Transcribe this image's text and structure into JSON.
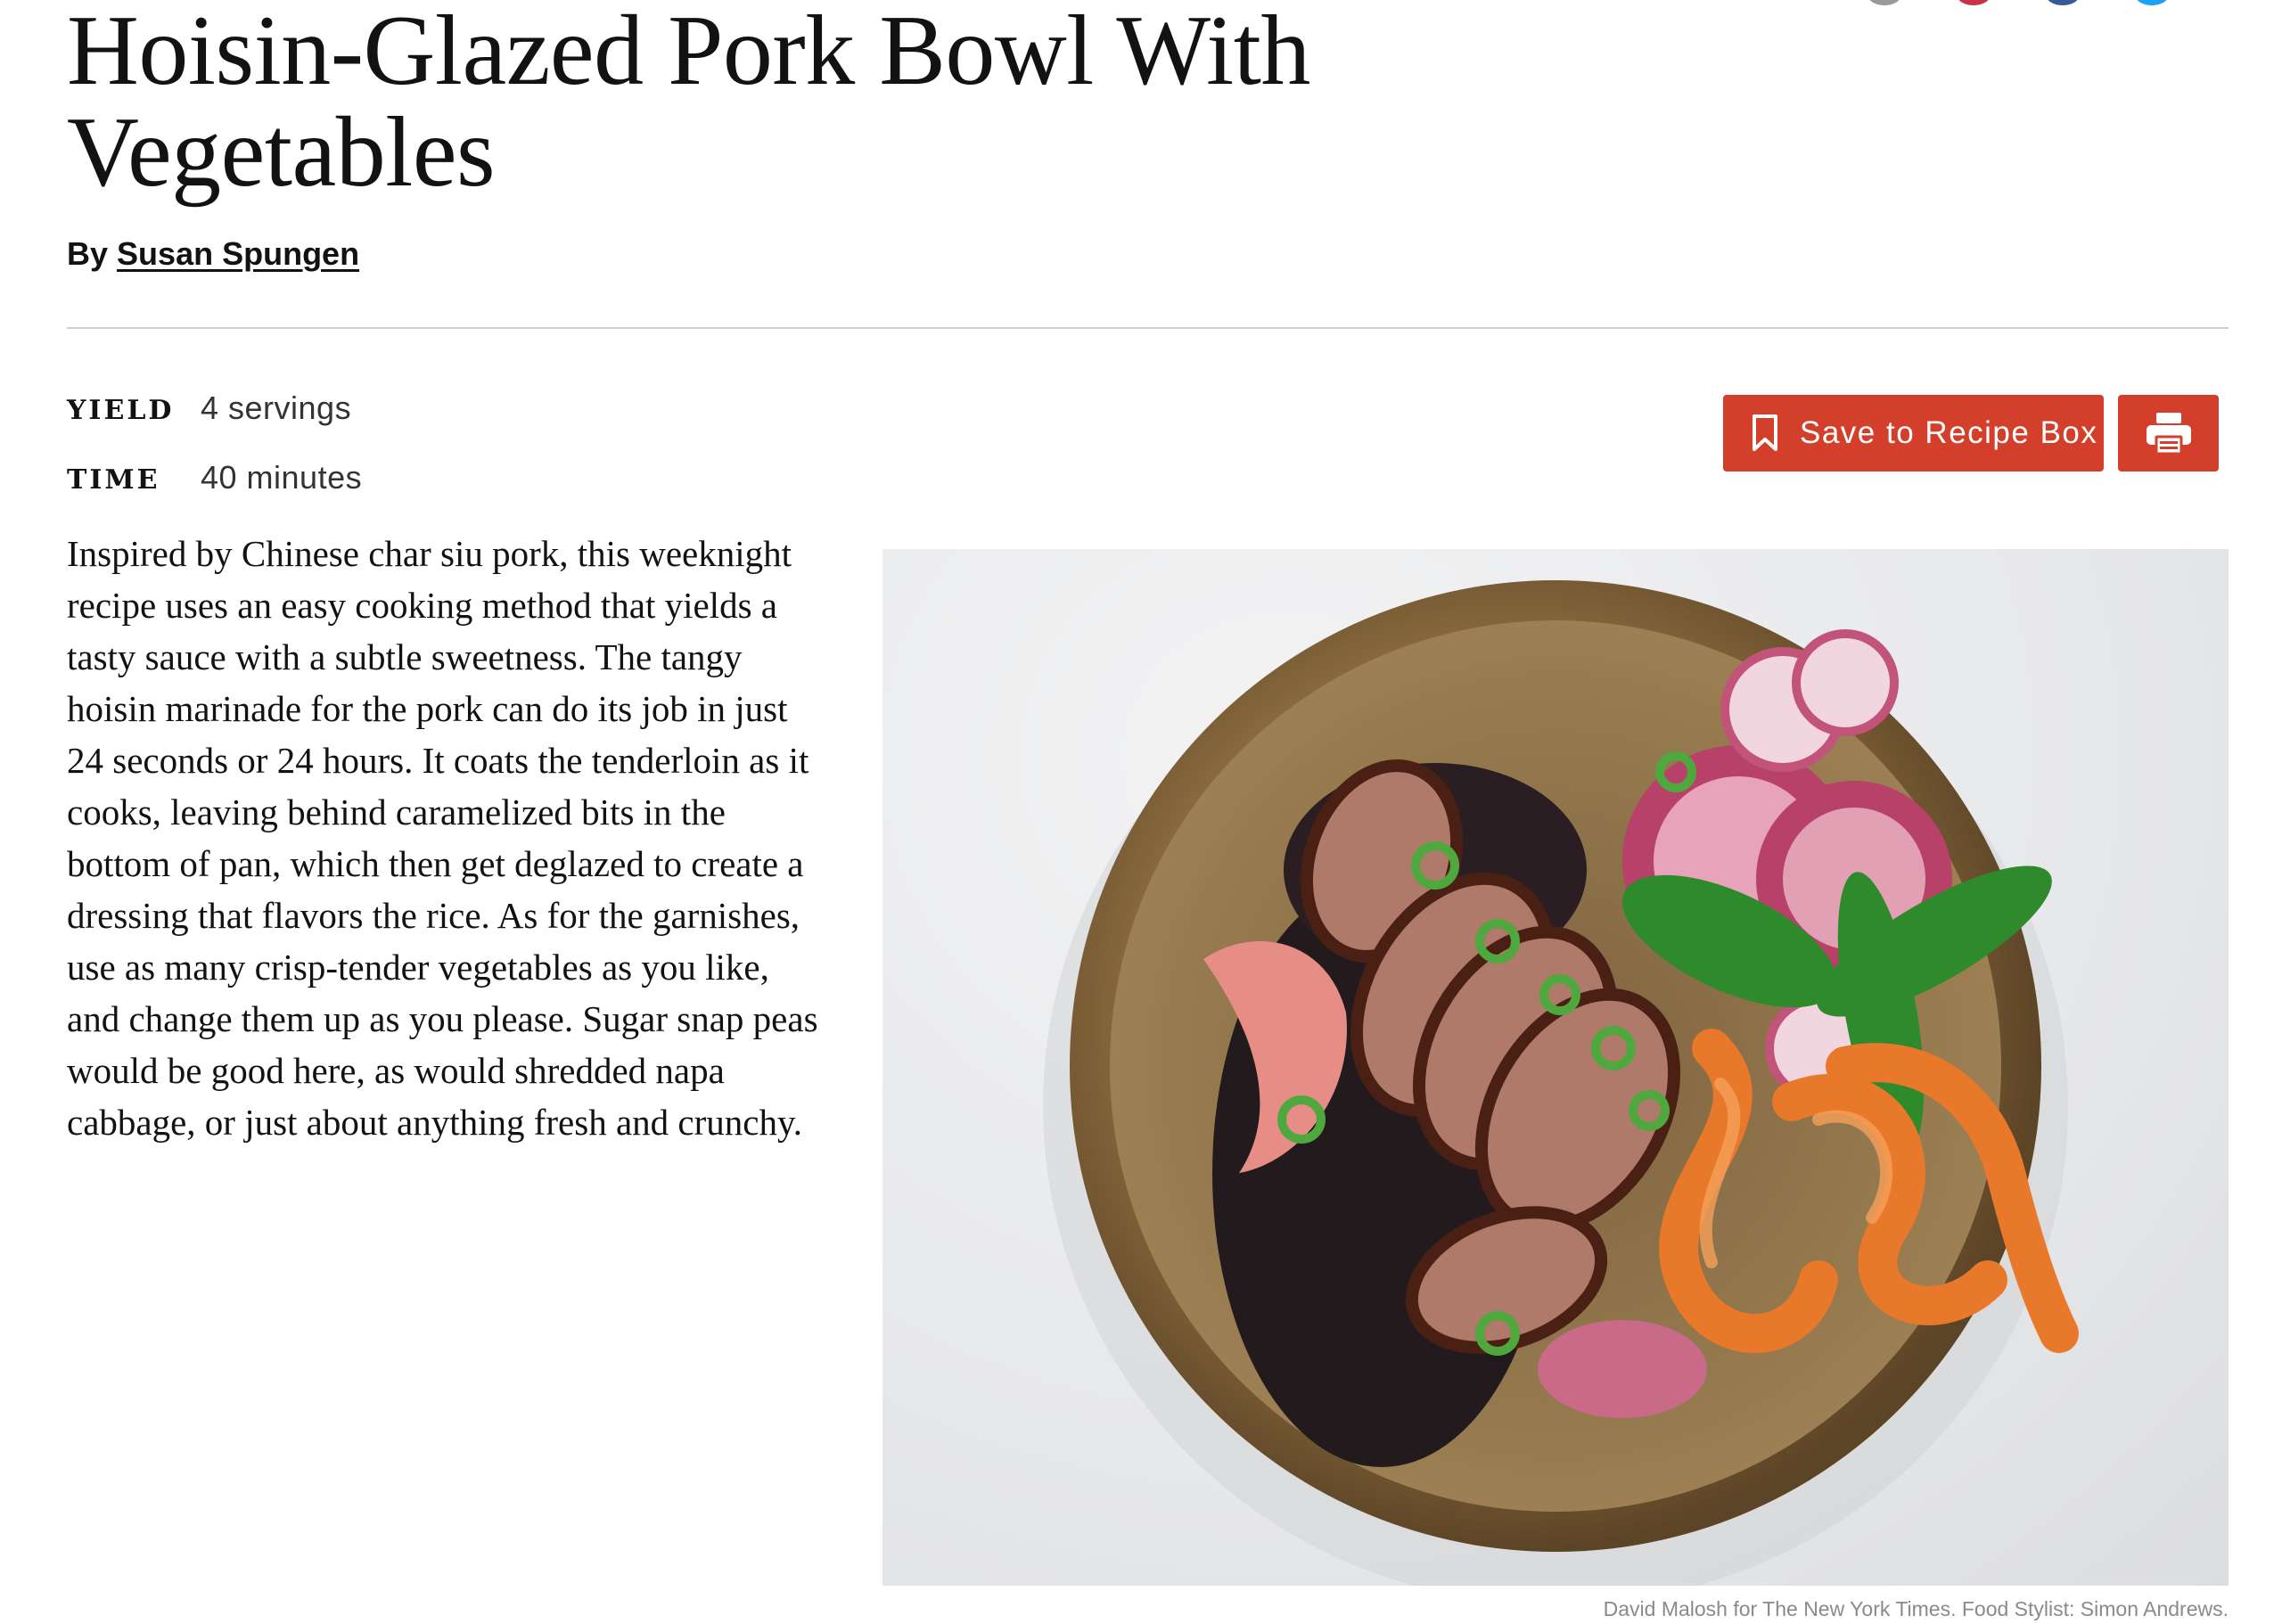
{
  "recipe": {
    "title": "Hoisin-Glazed Pork Bowl With Vegetables",
    "byline_prefix": "By",
    "author": "Susan Spungen",
    "yield_label": "YIELD",
    "yield_value": "4 servings",
    "time_label": "TIME",
    "time_value": "40 minutes",
    "description": "Inspired by Chinese char siu pork, this weeknight recipe uses an easy cooking method that yields a tasty sauce with a subtle sweetness. The tangy hoisin marinade for the pork can do its job in just 24 seconds or 24 hours. It coats the tenderloin as it cooks, leaving behind caramelized bits in the bottom of pan, which then get deglazed to create a dressing that flavors the rice. As for the garnishes, use as many crisp-tender vegetables as you like, and change them up as you please. Sugar snap peas would be good here, as would shredded napa cabbage, or just about anything fresh and crunchy.",
    "photo_credit": "David Malosh for The New York Times. Food Stylist: Simon Andrews."
  },
  "actions": {
    "save_label": "Save to Recipe Box",
    "save_icon": "bookmark-icon",
    "print_icon": "printer-icon"
  },
  "colors": {
    "accent": "#d33f2a",
    "text": "#121212",
    "muted": "#8a8a8a",
    "rule": "#cfcfcf"
  }
}
